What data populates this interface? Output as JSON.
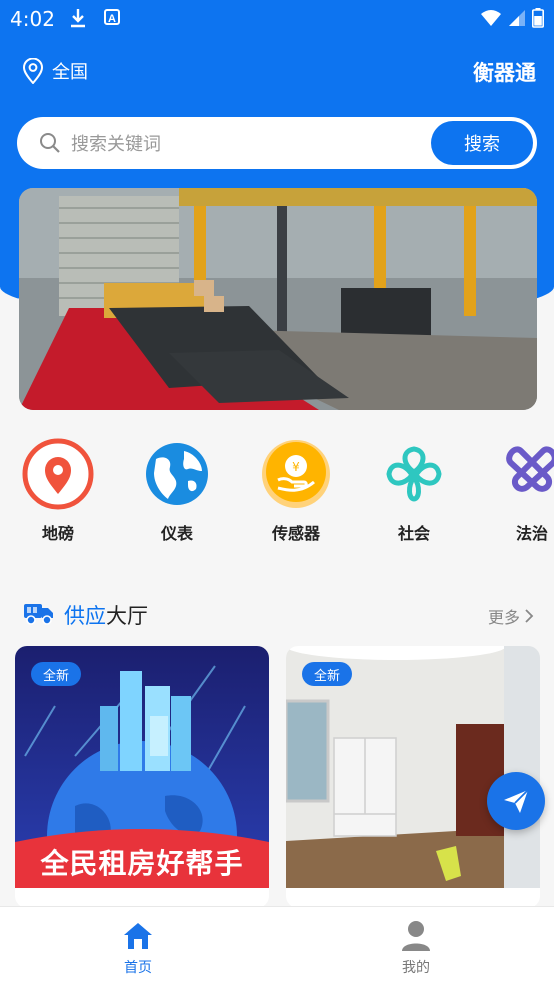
{
  "status_bar": {
    "time": "4:02"
  },
  "header": {
    "location": "全国",
    "brand": "衡器通"
  },
  "search": {
    "placeholder": "搜索关键词",
    "button": "搜索"
  },
  "categories": [
    {
      "label": "地磅",
      "icon": "map-pin-icon",
      "color": "#f0533c"
    },
    {
      "label": "仪表",
      "icon": "globe-icon",
      "color": "#1a8ce0"
    },
    {
      "label": "传感器",
      "icon": "money-hand-icon",
      "color": "#ffb400"
    },
    {
      "label": "社会",
      "icon": "clover-icon",
      "color": "#2ec7c0"
    },
    {
      "label": "法治",
      "icon": "heart-link-icon",
      "color": "#6a5ac8"
    }
  ],
  "supply_section": {
    "title_accent": "供应",
    "title_rest": "大厅",
    "more": "更多"
  },
  "cards": [
    {
      "badge": "全新",
      "poster_text": "全民租房好帮手"
    },
    {
      "badge": "全新"
    }
  ],
  "tabbar": {
    "home": "首页",
    "mine": "我的",
    "active_color": "#1a73e8",
    "inactive_color": "#777777"
  }
}
